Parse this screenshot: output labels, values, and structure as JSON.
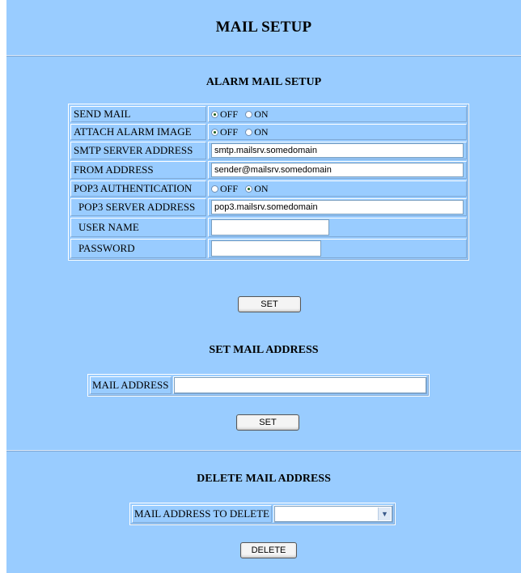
{
  "header": {
    "title": "MAIL SETUP"
  },
  "alarm": {
    "title": "ALARM MAIL SETUP",
    "send_mail": {
      "label": "SEND MAIL",
      "off": "OFF",
      "on": "ON",
      "selected": "OFF"
    },
    "attach_image": {
      "label": "ATTACH ALARM IMAGE",
      "off": "OFF",
      "on": "ON",
      "selected": "OFF"
    },
    "smtp": {
      "label": "SMTP SERVER ADDRESS",
      "value": "smtp.mailsrv.somedomain"
    },
    "from": {
      "label": "FROM ADDRESS",
      "value": "sender@mailsrv.somedomain"
    },
    "pop3_auth": {
      "label": "POP3 AUTHENTICATION",
      "off": "OFF",
      "on": "ON",
      "selected": "ON"
    },
    "pop3_server": {
      "label": "POP3 SERVER ADDRESS",
      "value": "pop3.mailsrv.somedomain"
    },
    "user": {
      "label": "USER NAME",
      "value": ""
    },
    "password": {
      "label": "PASSWORD",
      "value": ""
    },
    "set_label": "SET"
  },
  "set_mail": {
    "title": "SET MAIL ADDRESS",
    "label": "MAIL ADDRESS",
    "value": "",
    "set_label": "SET"
  },
  "delete_mail": {
    "title": "DELETE MAIL ADDRESS",
    "label": "MAIL ADDRESS TO DELETE",
    "selected": "",
    "delete_label": "DELETE"
  }
}
